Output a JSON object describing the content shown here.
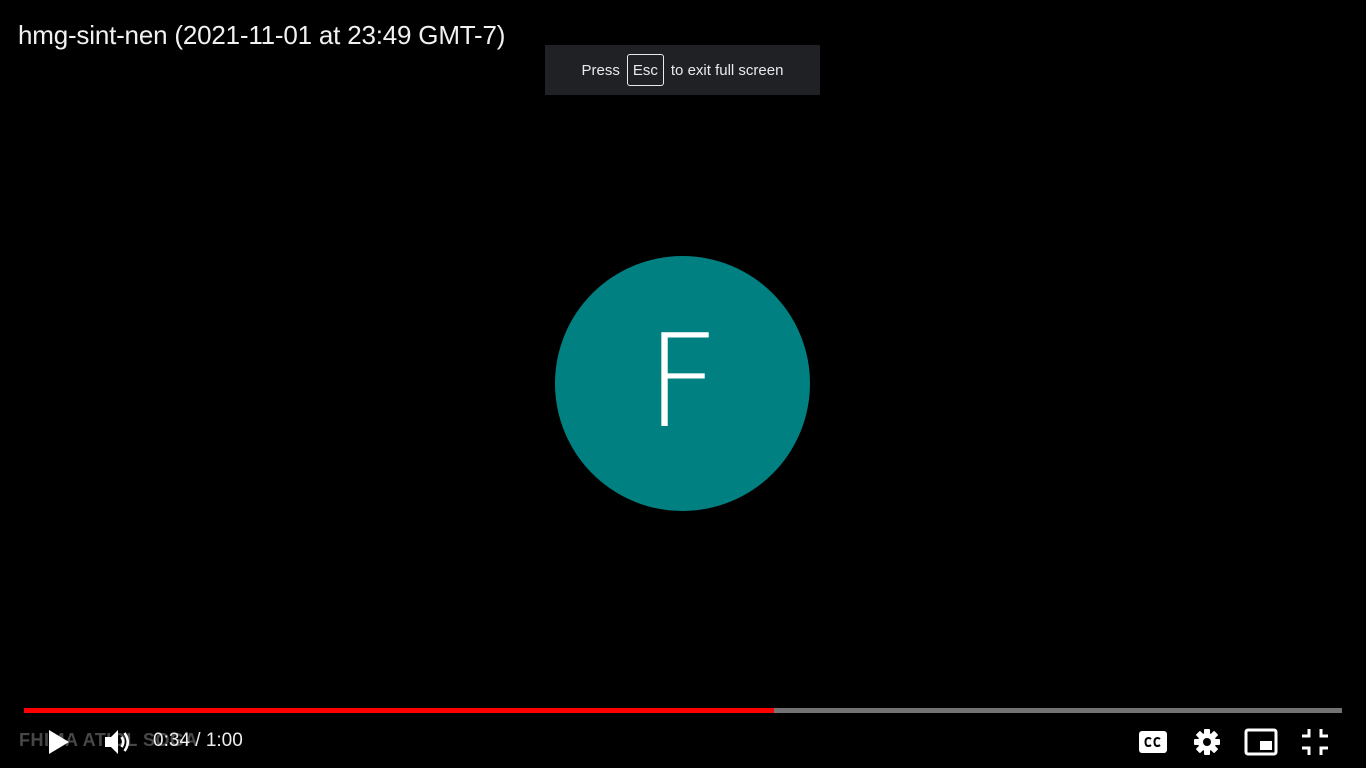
{
  "video": {
    "title": "hmg-sint-nen (2021-11-01 at 23:49 GMT-7)",
    "avatar_letter": "F",
    "avatar_color": "#008080",
    "watermark": "FHIMA ATIOL SOGA"
  },
  "fullscreen_notice": {
    "press": "Press",
    "key": "Esc",
    "suffix": "to exit full screen"
  },
  "player": {
    "current_time": "0:34",
    "separator": "/",
    "duration": "1:00",
    "progress_fraction": 0.5691,
    "progress_color": "#ff0000",
    "controls": {
      "play": "play-icon",
      "volume": "volume-icon",
      "captions": "cc-icon",
      "settings": "gear-icon",
      "miniplayer": "miniplayer-icon",
      "exit_fullscreen": "exit-fullscreen-icon"
    }
  }
}
